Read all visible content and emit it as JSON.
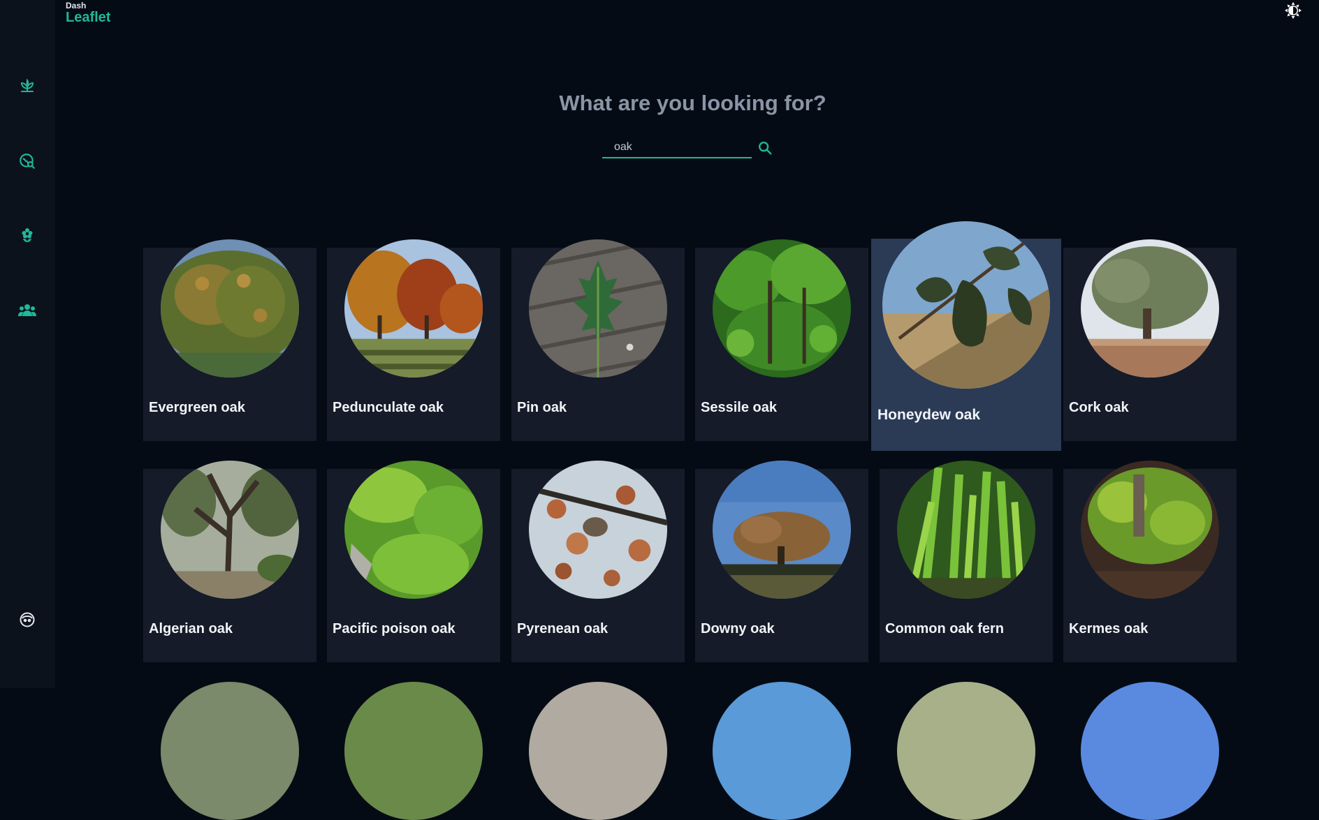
{
  "brand": {
    "small": "Dash",
    "name": "Leaflet"
  },
  "sidebar": {
    "items": [
      {
        "name": "plant-icon"
      },
      {
        "name": "map-search-icon"
      },
      {
        "name": "flower-icon"
      },
      {
        "name": "community-icon"
      }
    ],
    "bottom_icon": "robot-icon"
  },
  "header": {
    "theme_icon": "theme-toggle-icon"
  },
  "search": {
    "title": "What are you looking for?",
    "value": "oak",
    "icon": "search-icon"
  },
  "colors": {
    "accent": "#1fb89a",
    "background": "#050b14",
    "card": "#151b28",
    "card_highlight": "#2b3a55"
  },
  "results": [
    {
      "name": "Evergreen oak"
    },
    {
      "name": "Pedunculate oak"
    },
    {
      "name": "Pin oak"
    },
    {
      "name": "Sessile oak"
    },
    {
      "name": "Honeydew oak"
    },
    {
      "name": "Cork oak"
    },
    {
      "name": "Algerian oak"
    },
    {
      "name": "Pacific poison oak"
    },
    {
      "name": "Pyrenean oak"
    },
    {
      "name": "Downy oak"
    },
    {
      "name": "Common oak fern"
    },
    {
      "name": "Kermes oak"
    }
  ]
}
